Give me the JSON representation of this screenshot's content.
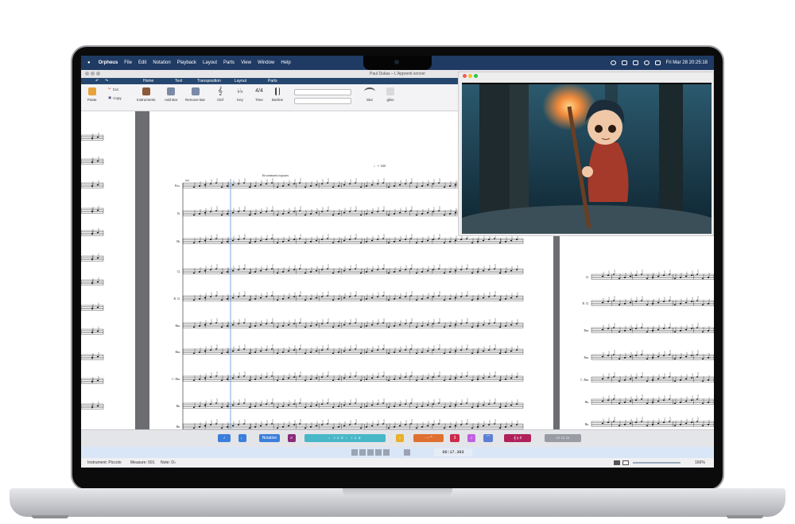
{
  "menubar": {
    "apple": "",
    "app_name": "Orpheus",
    "items": [
      "File",
      "Edit",
      "Notation",
      "Playback",
      "Layout",
      "Parts",
      "View",
      "Window",
      "Help"
    ],
    "datetime": "Fri Mar 28  20:25:18"
  },
  "window": {
    "title": "Paul Dukas – L'Apprenti sorcier",
    "tabs": [
      "Home",
      "Text",
      "Transposition",
      "Layout",
      "Parts"
    ]
  },
  "ribbon": {
    "paste": "Paste",
    "cut": "Cut",
    "copy": "Copy",
    "instruments": "Instruments",
    "add_bar": "Add Bar",
    "remove_bar": "Remove Bar",
    "clef": "Clef",
    "key": "Key",
    "time": "Time",
    "barline": "Barline",
    "slur": "Slur",
    "gliss": "gliss"
  },
  "score": {
    "tempo": "♩= 140",
    "expression": "En animant toujours",
    "bar_number": "691",
    "staves_left": [
      "Picc.",
      "Fl.",
      "Ob.",
      "Cl.",
      "B. Cl.",
      "Bsn.",
      "Bsn.",
      "C. Bsn.",
      "Hn.",
      "Hn."
    ],
    "staves_right": [
      "Cl.",
      "B. Cl.",
      "Bsn.",
      "Bsn.",
      "C. Bsn.",
      "Hn.",
      "Hn.",
      "Tpt."
    ]
  },
  "palette": {
    "notation_label": "Notation",
    "time": "06:17.393"
  },
  "status": {
    "instrument": "Instrument: Piccolo",
    "measure": "Measure: 691",
    "note": "Note: D♭",
    "zoom": "166%"
  }
}
